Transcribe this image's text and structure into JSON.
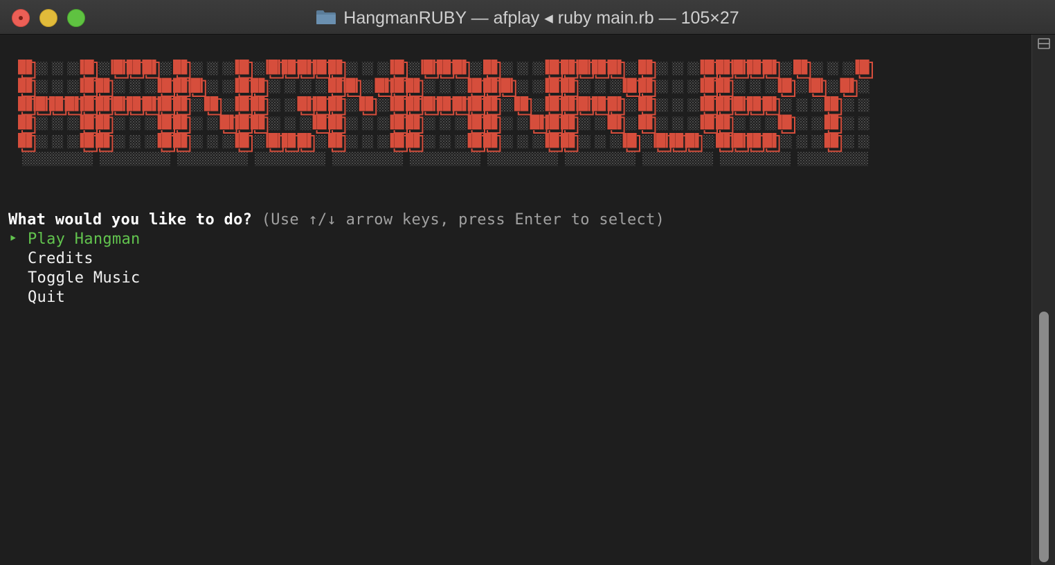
{
  "window": {
    "title": "HangmanRUBY — afplay ◂ ruby main.rb — 105×27",
    "folder_icon": "folder-icon",
    "buttons": [
      "close",
      "minimize",
      "zoom"
    ]
  },
  "banner": {
    "text": "HANGMANRUBY",
    "color": "#d64e3c"
  },
  "prompt": {
    "question": "What would you like to do?",
    "hint": " (Use ↑/↓ arrow keys, press Enter to select)"
  },
  "menu": {
    "pointer": "‣",
    "items": [
      {
        "label": "Play Hangman",
        "selected": true
      },
      {
        "label": "Credits",
        "selected": false
      },
      {
        "label": "Toggle Music",
        "selected": false
      },
      {
        "label": "Quit",
        "selected": false
      }
    ]
  },
  "colors": {
    "background": "#1e1e1e",
    "selected": "#62c44e",
    "banner": "#d64e3c"
  }
}
